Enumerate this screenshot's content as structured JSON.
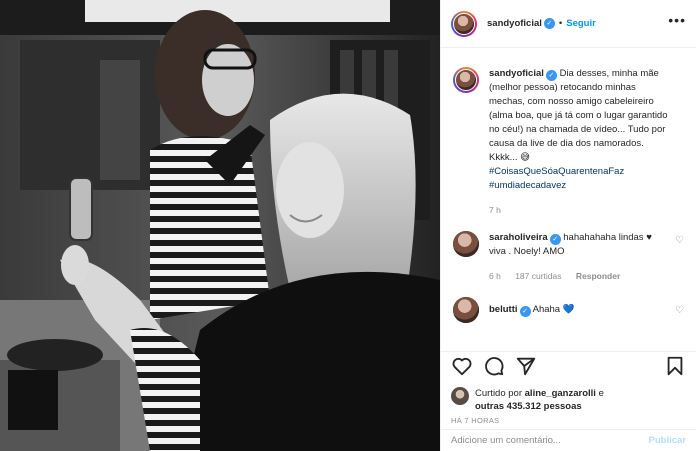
{
  "post": {
    "author": "sandyoficial",
    "follow_label": "Seguir",
    "dot": "•",
    "more": "•••"
  },
  "caption": {
    "user": "sandyoficial",
    "text": "Dia desses, minha mãe (melhor pessoa) retocando minhas mechas, com nosso amigo cabeleireiro (alma boa, que já tá com o lugar garantido no céu!) na chamada de vídeo... Tudo por causa da live de dia dos namorados. Kkkk... 😅",
    "hashtag1": "#CoisasQueSóaQuarentenaFaz",
    "hashtag2": "#umdiadecadavez",
    "time": "7 h"
  },
  "comments": [
    {
      "user": "saraholiveira",
      "text": "hahahahaha lindas ♥ viva . Noely! AMO",
      "time": "6 h",
      "likes": "187 curtidas",
      "reply": "Responder"
    },
    {
      "user": "belutti",
      "text": "Ahaha 💙"
    }
  ],
  "likes": {
    "prefix": "Curtido por",
    "user": "aline_ganzarolli",
    "connector": "e",
    "others": "outras 435.312 pessoas"
  },
  "posted_ago": "HÁ 7 HORAS",
  "add_comment": {
    "placeholder": "Adicione um comentário...",
    "publish_label": "Publicar"
  },
  "colors": {
    "link_blue": "#0095f6",
    "verified_blue": "#3897f0",
    "hashtag": "#00376b",
    "muted": "#8e8e8e"
  },
  "icons": [
    "heart-icon",
    "comment-icon",
    "share-icon",
    "bookmark-icon",
    "verified-icon"
  ]
}
